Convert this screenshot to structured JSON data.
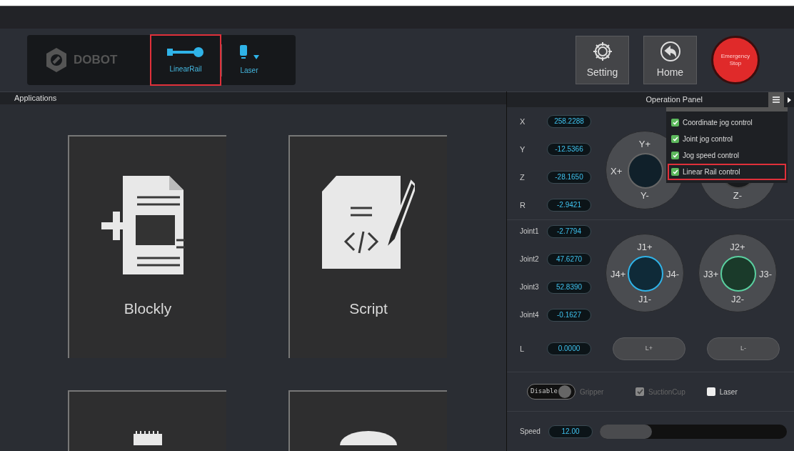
{
  "toolbar": {
    "logo": "DOBOT",
    "tools": [
      {
        "label": "LinearRail",
        "kind": "rail",
        "highlighted": true,
        "dropdown": false
      },
      {
        "label": "Laser",
        "kind": "laser",
        "highlighted": false,
        "dropdown": true
      }
    ],
    "buttons": [
      {
        "label": "Setting",
        "kind": "gear"
      },
      {
        "label": "Home",
        "kind": "home"
      }
    ],
    "emergency": "Emergency Stop"
  },
  "applications": {
    "title": "Applications",
    "tiles": [
      {
        "label": "Blockly",
        "kind": "blockly"
      },
      {
        "label": "Script",
        "kind": "script"
      },
      {
        "kind": "device"
      },
      {
        "kind": "round"
      }
    ]
  },
  "operation_panel": {
    "title": "Operation Panel",
    "menu": [
      {
        "label": "Coordinate jog control",
        "checked": true,
        "highlighted": false
      },
      {
        "label": "Joint jog control",
        "checked": true,
        "highlighted": false
      },
      {
        "label": "Jog speed control",
        "checked": true,
        "highlighted": false
      },
      {
        "label": "Linear Rail control",
        "checked": true,
        "highlighted": true
      }
    ],
    "coordinates": [
      {
        "name": "X",
        "value": "258.2288"
      },
      {
        "name": "Y",
        "value": "-12.5366"
      },
      {
        "name": "Z",
        "value": "-28.1650"
      },
      {
        "name": "R",
        "value": "-2.9421"
      }
    ],
    "coordinate_wheels": [
      {
        "top": "Y+",
        "left": "X+",
        "bottom": "Y-",
        "kind": "xy"
      },
      {
        "bottom": "Z-",
        "kind": "z"
      }
    ],
    "joints": [
      {
        "name": "Joint1",
        "value": "-2.7794"
      },
      {
        "name": "Joint2",
        "value": "47.6270"
      },
      {
        "name": "Joint3",
        "value": "52.8390"
      },
      {
        "name": "Joint4",
        "value": "-0.1627"
      }
    ],
    "joint_wheels": [
      {
        "top": "J1+",
        "left": "J4+",
        "bottom": "J1-",
        "right": "J4-",
        "kind": "j14"
      },
      {
        "top": "J2+",
        "left": "J3+",
        "bottom": "J2-",
        "right": "J3-",
        "kind": "j23"
      }
    ],
    "rail": {
      "name": "L",
      "value": "0.0000",
      "buttons": [
        "L+",
        "L-"
      ]
    },
    "end_effector": {
      "toggle": "Disable",
      "on": false,
      "gripper": "Gripper",
      "suction": {
        "label": "SuctionCup",
        "checked": true,
        "disabled": true
      },
      "laser": {
        "label": "Laser",
        "checked": false,
        "disabled": false
      }
    },
    "speed": {
      "label": "Speed",
      "value": "12.00",
      "level": 0.28
    }
  }
}
